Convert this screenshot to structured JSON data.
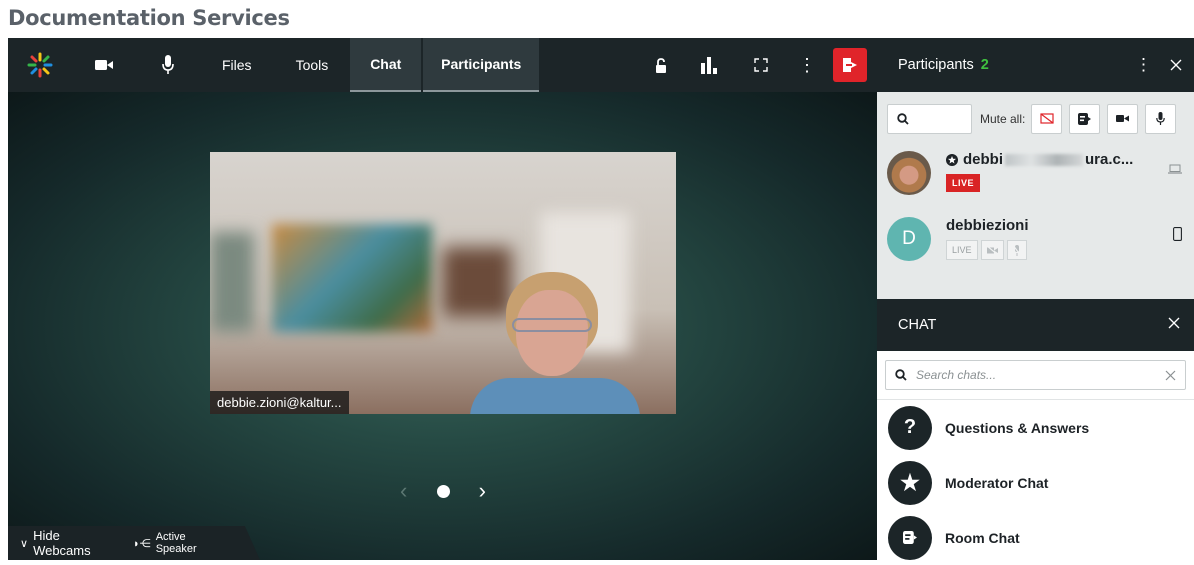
{
  "page": {
    "title": "Documentation Services"
  },
  "toolbar": {
    "files_label": "Files",
    "tools_label": "Tools",
    "chat_tab": "Chat",
    "participants_tab": "Participants"
  },
  "stage": {
    "video_name_tag": "debbie.zioni@kaltur...",
    "hide_webcams_label": "Hide Webcams",
    "active_speaker_label": "Active Speaker"
  },
  "participants_panel": {
    "title": "Participants",
    "count": "2",
    "search_placeholder": "",
    "mute_all_label": "Mute all:",
    "participants": [
      {
        "name_start": "debbi",
        "name_end": "ura.c...",
        "live": "LIVE",
        "device": "laptop-icon"
      },
      {
        "initial": "D",
        "name": "debbiezioni",
        "live": "LIVE",
        "device": "phone-icon"
      }
    ]
  },
  "chat_panel": {
    "title": "CHAT",
    "search_placeholder": "Search chats...",
    "items": [
      {
        "label": "Questions & Answers",
        "icon": "question-icon"
      },
      {
        "label": "Moderator Chat",
        "icon": "star-icon"
      },
      {
        "label": "Room Chat",
        "icon": "chat-icon"
      }
    ]
  },
  "colors": {
    "accent_green": "#3fc23f",
    "live_red": "#d92425",
    "exit_red": "#e0242a",
    "dark": "#1c2528"
  }
}
